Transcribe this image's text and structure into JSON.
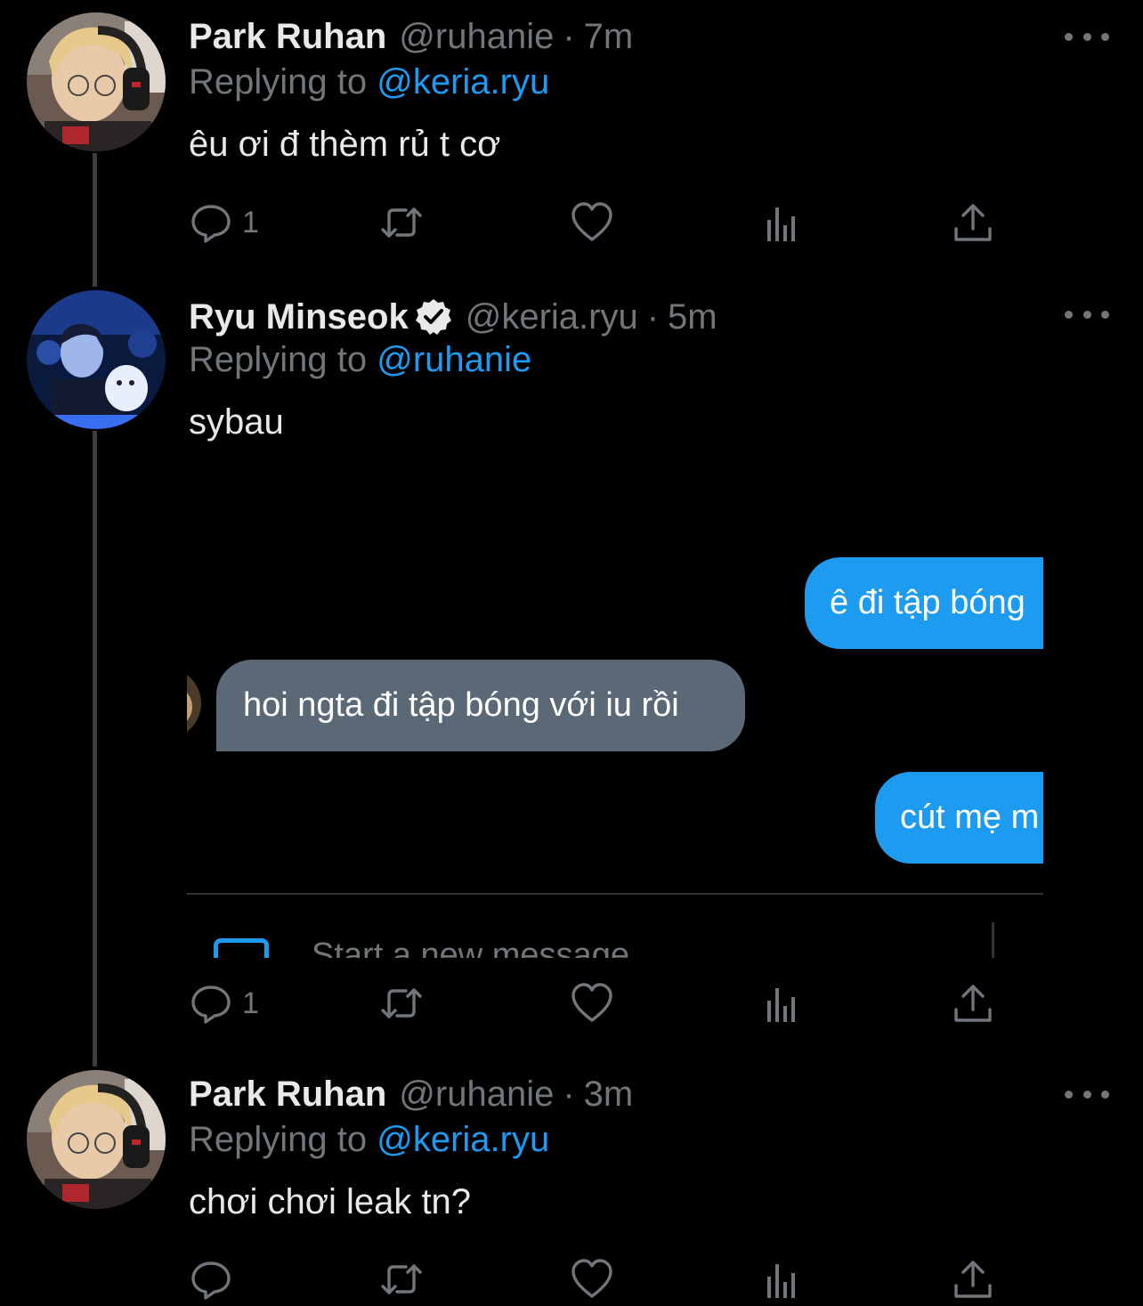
{
  "tweets": [
    {
      "display_name": "Park Ruhan",
      "handle": "@ruhanie",
      "separator": "·",
      "time": "7m",
      "replying_prefix": "Replying to",
      "replying_handle": "@keria.ryu",
      "text": "êu ơi đ thèm rủ t cơ",
      "reply_count": "1",
      "verified": false
    },
    {
      "display_name": "Ryu Minseok",
      "handle": "@keria.ryu",
      "separator": "·",
      "time": "5m",
      "replying_prefix": "Replying to",
      "replying_handle": "@ruhanie",
      "text": "sybau",
      "reply_count": "1",
      "verified": true,
      "embedded_dm": {
        "messages": [
          {
            "from": "me",
            "text": "ê đi tập bóng"
          },
          {
            "from": "them",
            "text": "hoi ngta đi tập bóng với iu rồi"
          },
          {
            "from": "me",
            "text": "cút mẹ m"
          }
        ],
        "compose_placeholder": "Start a new message"
      }
    },
    {
      "display_name": "Park Ruhan",
      "handle": "@ruhanie",
      "separator": "·",
      "time": "3m",
      "replying_prefix": "Replying to",
      "replying_handle": "@keria.ryu",
      "text": "chơi chơi leak tn?",
      "reply_count": "",
      "verified": false
    }
  ],
  "icons": {
    "reply": "reply-icon",
    "retweet": "retweet-icon",
    "like": "like-icon",
    "views": "views-icon",
    "share": "share-icon",
    "more": "more-icon",
    "verified": "verified-badge-icon"
  },
  "colors": {
    "background": "#000000",
    "text": "#e7e9ea",
    "muted": "#71767b",
    "accent": "#1d9bf0",
    "thread_line": "#3a3d41",
    "incoming_bubble": "#5b6977"
  }
}
